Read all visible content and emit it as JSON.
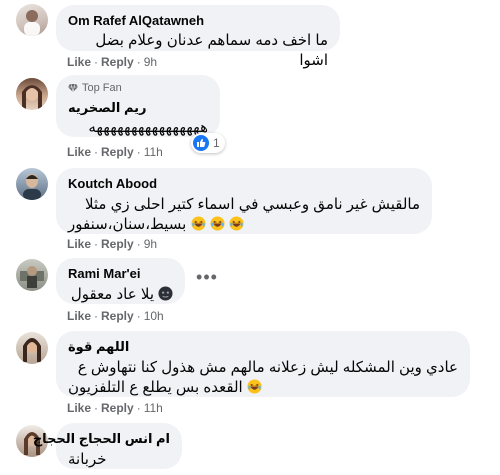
{
  "comments": [
    {
      "name": "Om Rafef AlQatawneh",
      "text": "ما اخف دمه سماهم عدنان وعلام بضل اشوا",
      "like_label": "Like",
      "reply_label": "Reply",
      "time": "9h"
    },
    {
      "badge": "Top Fan",
      "badge_icon": "diamond-icon",
      "name": "ريم الصخريه",
      "text": "ههههههههههههههههه",
      "like_label": "Like",
      "reply_label": "Reply",
      "time": "11h",
      "reaction_count": "1",
      "reaction_icon": "like-icon"
    },
    {
      "name": "Koutch Abood",
      "text_line1": "مالقيش غير نامق وعبسي في اسماء كتير احلى زي مثلا",
      "text_line2": "بسيط،سنان،سنفور",
      "like_label": "Like",
      "reply_label": "Reply",
      "time": "9h"
    },
    {
      "name": "Rami Mar'ei",
      "text": "يلا عاد معقول",
      "like_label": "Like",
      "reply_label": "Reply",
      "time": "10h"
    },
    {
      "name": "اللهم قوة",
      "text_line1": "عادي وين المشكله ليش زعلانه مالهم مش هذول كنا نتهاوش ع",
      "text_line2": "القعده بس يطلع ع التلفزيون",
      "like_label": "Like",
      "reply_label": "Reply",
      "time": "11h"
    },
    {
      "name": "ام انس الحجاج الحجاج",
      "text": "خربانة"
    }
  ],
  "more_label": "•••",
  "colors": {
    "bubble": "#f0f2f5",
    "meta": "#65676b",
    "like_blue": "#1877f2"
  }
}
